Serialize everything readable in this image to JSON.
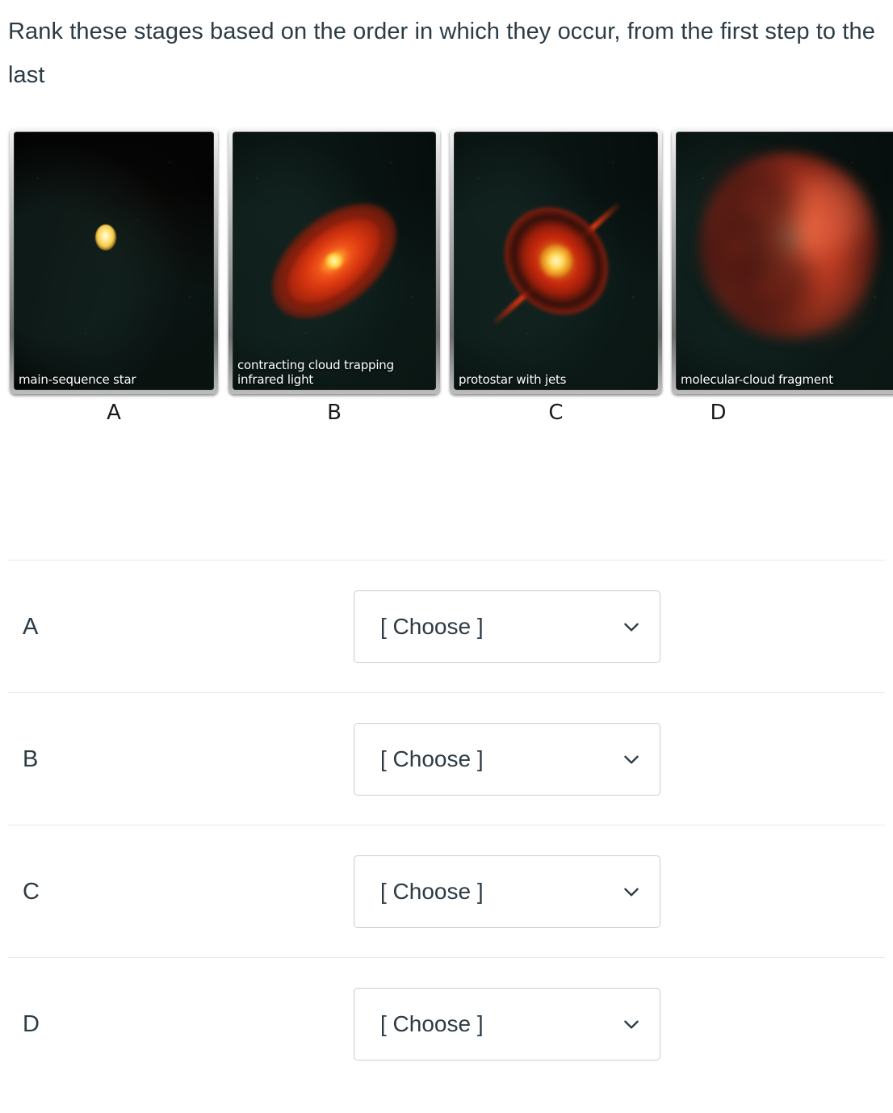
{
  "question": {
    "prompt": "Rank these stages based on the order in which they occur, from the first step to the last"
  },
  "figure": {
    "panels": [
      {
        "letter": "A",
        "caption": "main-sequence star",
        "scene": "lone yellow star on black sky"
      },
      {
        "letter": "B",
        "caption": "contracting cloud trapping infrared light",
        "scene": "tilted red-orange disk with bright yellow core"
      },
      {
        "letter": "C",
        "caption": "protostar with jets",
        "scene": "red disk with bright core and two bipolar red jets"
      },
      {
        "letter": "D",
        "caption": "molecular-cloud fragment",
        "scene": "diffuse red nebular cloud on dark teal sky"
      }
    ]
  },
  "answers": {
    "placeholder": "[ Choose ]",
    "chevron_icon": "chevron-down-icon",
    "rows": [
      {
        "label": "A",
        "value": "[ Choose ]"
      },
      {
        "label": "B",
        "value": "[ Choose ]"
      },
      {
        "label": "C",
        "value": "[ Choose ]"
      },
      {
        "label": "D",
        "value": "[ Choose ]"
      }
    ]
  },
  "colors": {
    "text": "#2d3b45",
    "divider": "#e8e9ea",
    "select_border": "#c7cdd1",
    "background": "#ffffff"
  }
}
